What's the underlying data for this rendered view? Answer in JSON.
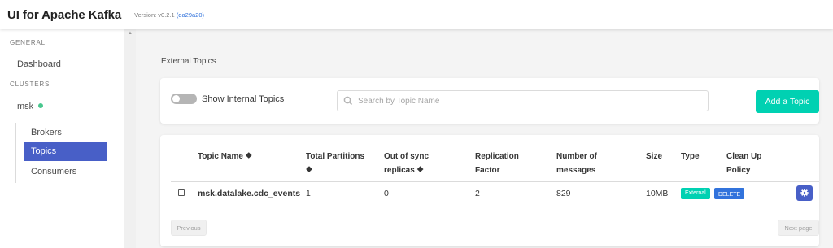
{
  "app": {
    "title": "UI for Apache Kafka",
    "version_prefix": "Version: v0.2.1",
    "version_hash": "(da29a20)"
  },
  "sidebar": {
    "general_label": "GENERAL",
    "dashboard": "Dashboard",
    "clusters_label": "CLUSTERS",
    "cluster_name": "msk",
    "cluster_status_color": "#48c78e",
    "items": [
      "Brokers",
      "Topics",
      "Consumers"
    ],
    "active_item": "Topics"
  },
  "page": {
    "title": "External Topics"
  },
  "toolbar": {
    "show_internal_label": "Show Internal Topics",
    "show_internal_enabled": false,
    "search_placeholder": "Search by Topic Name",
    "search_value": "",
    "add_topic_label": "Add a Topic"
  },
  "table": {
    "headers": {
      "topic_name": "Topic Name",
      "total_partitions": "Total Partitions",
      "out_of_sync": "Out of sync replicas",
      "replication_factor": "Replication Factor",
      "number_of_messages": "Number of messages",
      "size": "Size",
      "type": "Type",
      "clean_up_policy": "Clean Up Policy"
    },
    "sort_icon": "⯁",
    "rows": [
      {
        "topic_name": "msk.datalake.cdc_events",
        "total_partitions": "1",
        "out_of_sync": "0",
        "replication_factor": "2",
        "number_of_messages": "829",
        "size": "10MB",
        "type": "External",
        "clean_up_policy": "DELETE",
        "action_icon": "gear-icon"
      }
    ]
  },
  "pagination": {
    "previous": "Previous",
    "next": "Next page"
  },
  "colors": {
    "accent": "#485fc7",
    "primary": "#00d1b2",
    "link": "#3273dc"
  }
}
